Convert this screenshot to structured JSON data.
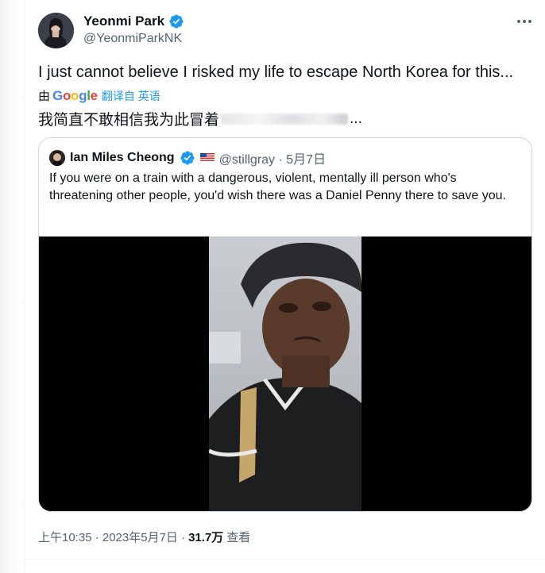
{
  "tweet": {
    "author_name": "Yeonmi Park",
    "author_handle": "@YeonmiParkNK",
    "text": "I just cannot believe I risked my life to escape North Korea for this...",
    "translate": {
      "by": "由",
      "google_g": "G",
      "google_o1": "o",
      "google_o2": "o",
      "google_g2": "g",
      "google_l": "l",
      "google_e": "e",
      "link": "翻译自 英语"
    },
    "translated_text": "我简直不敢相信我为此冒着",
    "translated_tail": "...",
    "footer": {
      "time": "上午10:35 · 2023年5月7日 ·",
      "views_count": "31.7万",
      "views_label": "查看"
    }
  },
  "quote": {
    "author_name": "Ian Miles Cheong",
    "author_handle_date": "@stillgray · 5月7日",
    "flag": "🇺🇸",
    "text": "If you were on a train with a dangerous, violent, mentally ill person who's threatening other people, you'd wish there was a Daniel Penny there to save you."
  },
  "colors": {
    "verified_blue": "#1d9bf0",
    "text_primary": "#0f1419",
    "text_secondary": "#536471",
    "border": "#cfd9de"
  },
  "icons": [
    "verified-badge-icon",
    "more-options-icon"
  ]
}
